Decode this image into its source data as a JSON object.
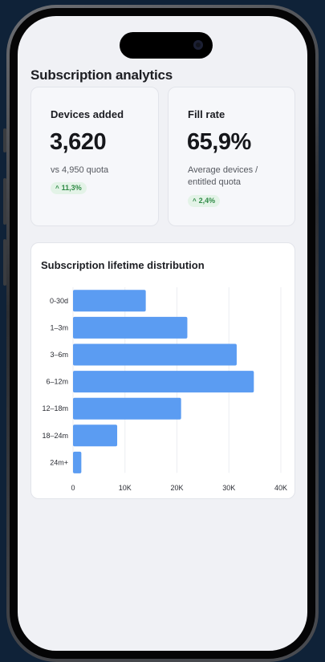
{
  "page": {
    "title": "Subscription analytics"
  },
  "kpis": [
    {
      "label": "Devices added",
      "value": "3,620",
      "subtitle": "vs 4,950 quota",
      "change": "11,3%"
    },
    {
      "label": "Fill rate",
      "value": "65,9%",
      "subtitle": "Average devices / entitled quota",
      "change": "2,4%"
    }
  ],
  "colors": {
    "bar": "#5b9cf2",
    "badge_bg": "#e3f3e7",
    "badge_text": "#2f8a46",
    "background": "#0f2238"
  },
  "icons": {
    "change": "arrow-up-icon"
  },
  "chart_data": {
    "type": "bar",
    "orientation": "horizontal",
    "title": "Subscription lifetime distribution",
    "categories": [
      "0-30d",
      "1–3m",
      "3–6m",
      "6–12m",
      "12–18m",
      "18–24m",
      "24m+"
    ],
    "values": [
      14000,
      22000,
      31500,
      34800,
      20800,
      8500,
      1600
    ],
    "xlim": [
      0,
      40000
    ],
    "x_ticks": [
      0,
      10000,
      20000,
      30000,
      40000
    ],
    "x_tick_labels": [
      "0",
      "10K",
      "20K",
      "30K",
      "40K"
    ],
    "grid": true,
    "legend": "none"
  }
}
